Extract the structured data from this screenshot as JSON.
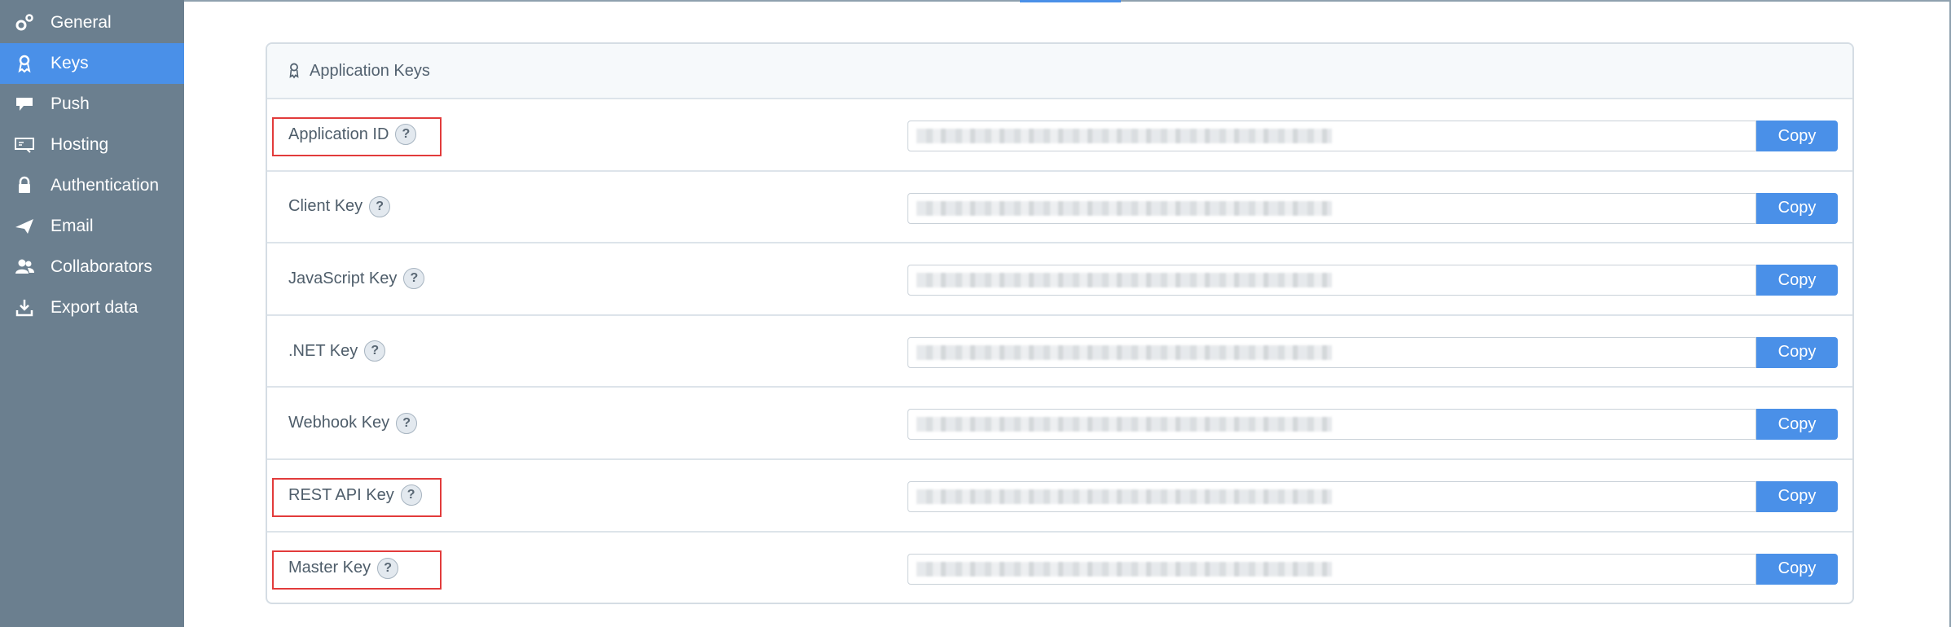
{
  "sidebar": {
    "items": [
      {
        "label": "General",
        "icon": "gear-icon",
        "active": false
      },
      {
        "label": "Keys",
        "icon": "key-icon",
        "active": true
      },
      {
        "label": "Push",
        "icon": "push-icon",
        "active": false
      },
      {
        "label": "Hosting",
        "icon": "hosting-icon",
        "active": false
      },
      {
        "label": "Authentication",
        "icon": "lock-icon",
        "active": false
      },
      {
        "label": "Email",
        "icon": "paper-plane-icon",
        "active": false
      },
      {
        "label": "Collaborators",
        "icon": "users-icon",
        "active": false
      },
      {
        "label": "Export data",
        "icon": "download-icon",
        "active": false
      }
    ]
  },
  "panel": {
    "title": "Application Keys",
    "help_glyph": "?",
    "copy_label": "Copy",
    "keys": [
      {
        "label": "Application ID",
        "highlighted": true
      },
      {
        "label": "Client Key",
        "highlighted": false
      },
      {
        "label": "JavaScript Key",
        "highlighted": false
      },
      {
        "label": ".NET Key",
        "highlighted": false
      },
      {
        "label": "Webhook Key",
        "highlighted": false
      },
      {
        "label": "REST API Key",
        "highlighted": true
      },
      {
        "label": "Master Key",
        "highlighted": true
      }
    ]
  },
  "colors": {
    "sidebar_bg": "#6b7f8f",
    "accent": "#4a90e8",
    "highlight": "#e23b3b"
  }
}
